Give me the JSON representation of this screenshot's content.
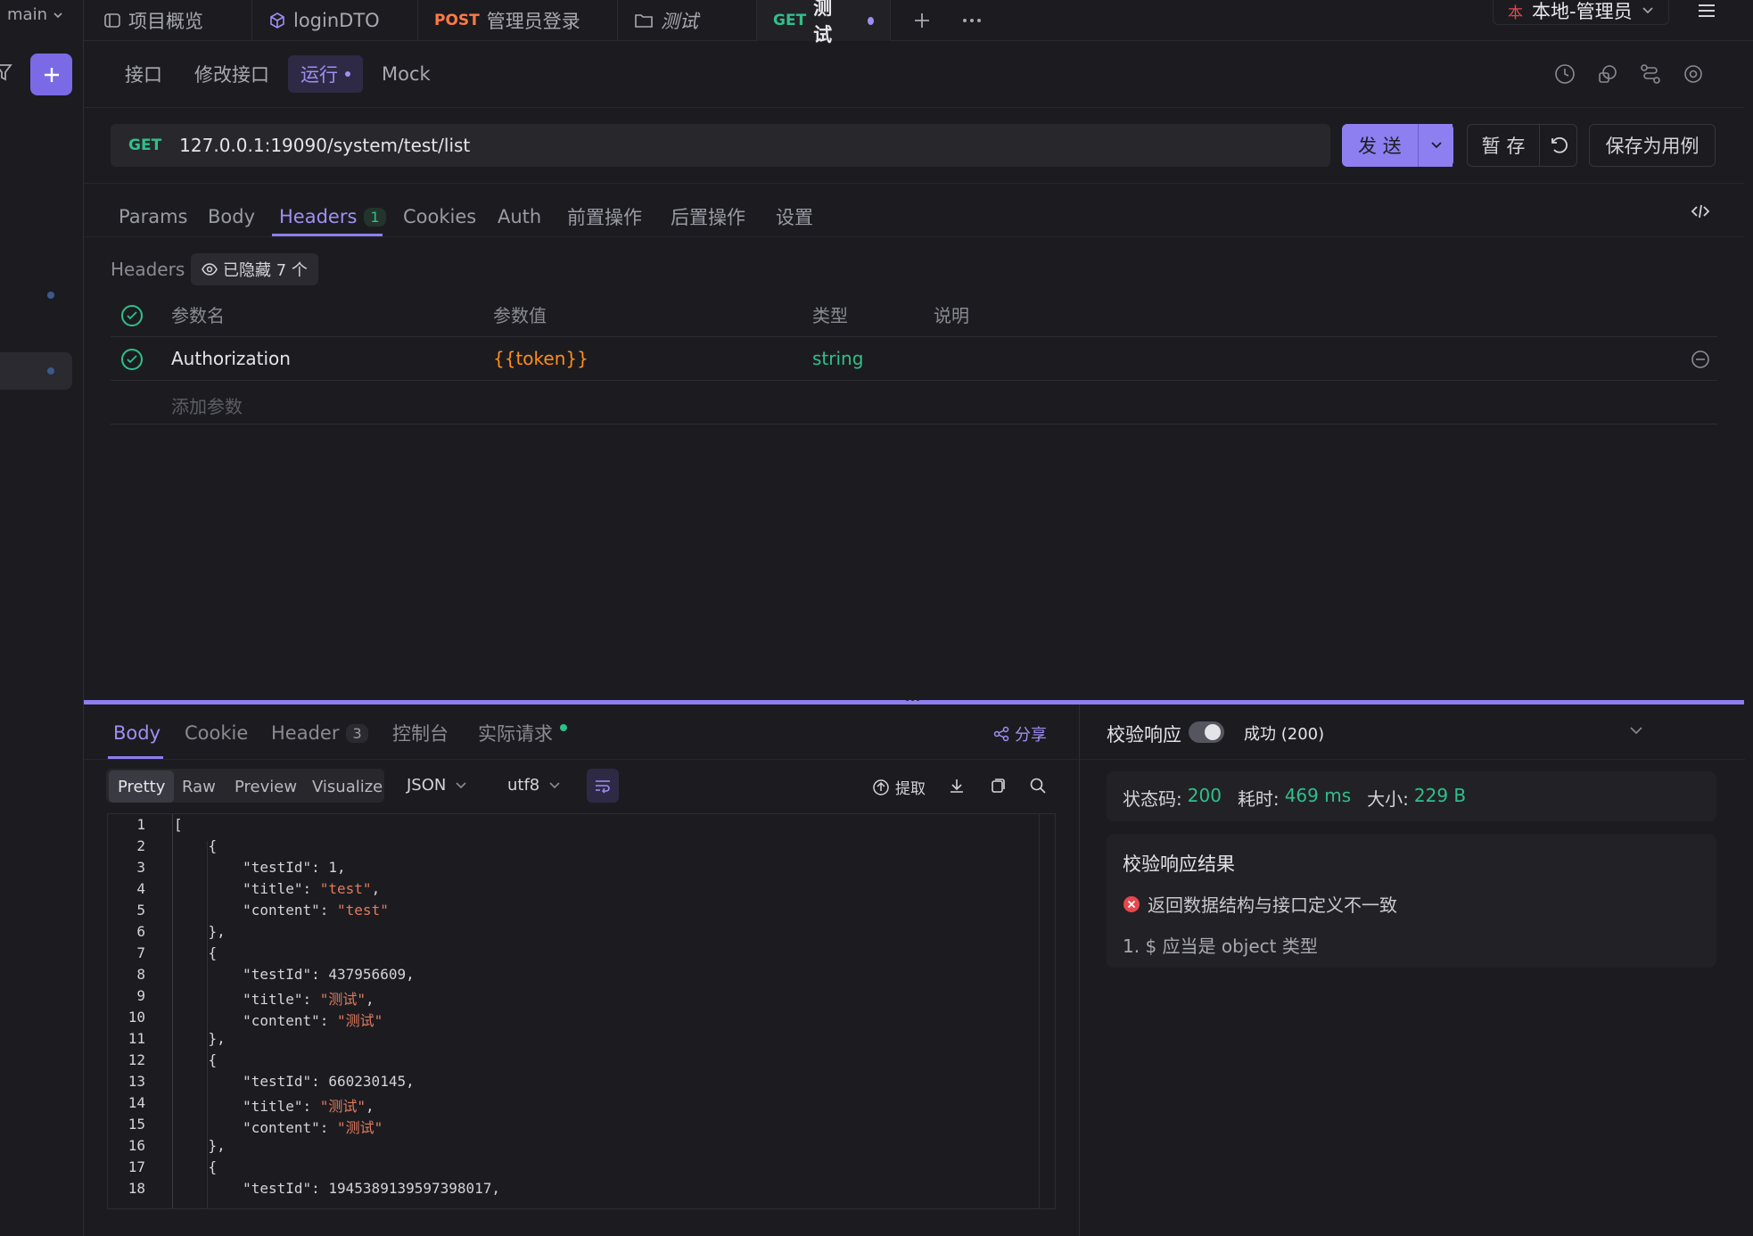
{
  "branch": "main",
  "tabs": [
    {
      "method": "",
      "label": "项目概览"
    },
    {
      "method": "",
      "label": "loginDTO"
    },
    {
      "method": "POST",
      "label": "管理员登录"
    },
    {
      "method": "",
      "label": "测试"
    },
    {
      "method": "GET",
      "label": "测试"
    }
  ],
  "env": {
    "mark": "本",
    "label": "本地-管理员"
  },
  "subnav": [
    "接口",
    "修改接口",
    "运行",
    "Mock"
  ],
  "request": {
    "method": "GET",
    "url": "127.0.0.1:19090/system/test/list"
  },
  "buttons": {
    "send": "发 送",
    "save_temp": "暂 存",
    "save_case": "保存为用例"
  },
  "req_tabs": {
    "params": "Params",
    "body": "Body",
    "headers": "Headers",
    "headers_count": "1",
    "cookies": "Cookies",
    "auth": "Auth",
    "pre": "前置操作",
    "post": "后置操作",
    "settings": "设置"
  },
  "headers_section": {
    "label": "Headers",
    "hidden": "已隐藏 7 个",
    "columns": {
      "name": "参数名",
      "value": "参数值",
      "type": "类型",
      "desc": "说明"
    },
    "rows": [
      {
        "name": "Authorization",
        "value": "{{token}}",
        "type": "string"
      }
    ],
    "add_placeholder": "添加参数"
  },
  "resp_tabs": {
    "body": "Body",
    "cookie": "Cookie",
    "header": "Header",
    "header_count": "3",
    "console": "控制台",
    "actual": "实际请求",
    "share": "分享"
  },
  "resp_view": {
    "pretty": "Pretty",
    "raw": "Raw",
    "preview": "Preview",
    "visualize": "Visualize",
    "format": "JSON",
    "encoding": "utf8",
    "extract": "提取"
  },
  "code_lines": [
    "[",
    "    {",
    "        \"testId\": 1,",
    "        \"title\": \"test\",",
    "        \"content\": \"test\"",
    "    },",
    "    {",
    "        \"testId\": 437956609,",
    "        \"title\": \"测试\",",
    "        \"content\": \"测试\"",
    "    },",
    "    {",
    "        \"testId\": 660230145,",
    "        \"title\": \"测试\",",
    "        \"content\": \"测试\"",
    "    },",
    "    {",
    "        \"testId\": 1945389139597398017,"
  ],
  "validate": {
    "label": "校验响应",
    "status_text": "成功 (200)",
    "status_code_label": "状态码:",
    "status_code": "200",
    "time_label": "耗时:",
    "time": "469 ms",
    "size_label": "大小:",
    "size": "229 B",
    "result_title": "校验响应结果",
    "error": "返回数据结构与接口定义不一致",
    "detail": "1. $ 应当是 object 类型"
  },
  "colors": {
    "accent": "#9f8ff5",
    "green": "#2fc08a",
    "orange": "#ff7a45",
    "error": "#e5484d"
  }
}
